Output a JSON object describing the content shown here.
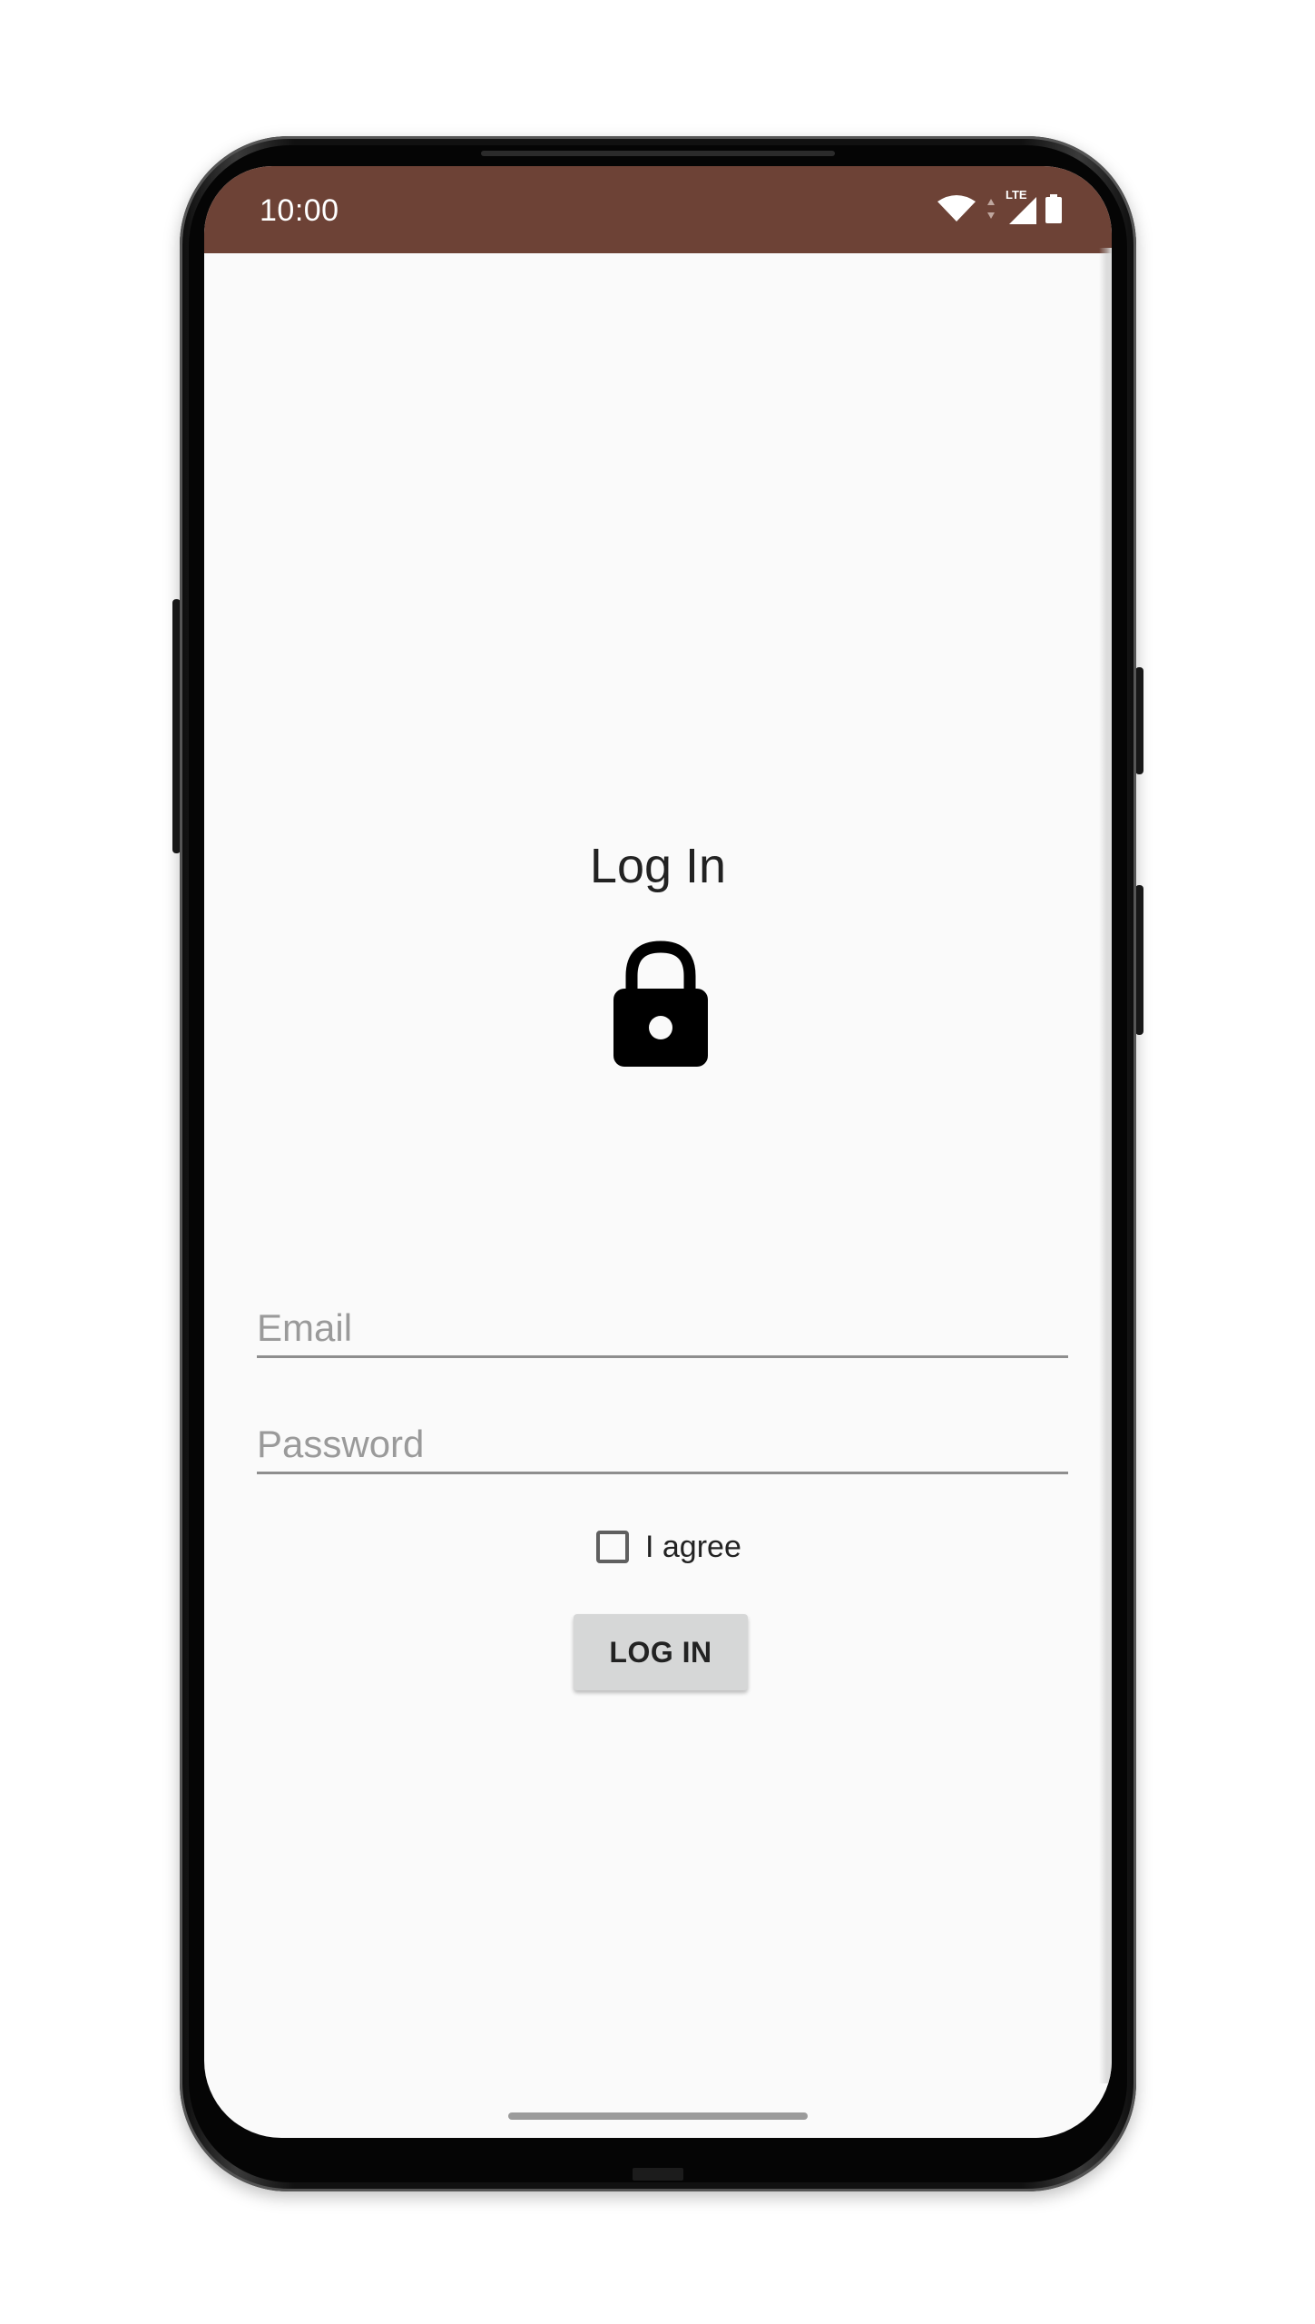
{
  "status_bar": {
    "time": "10:00",
    "network_label": "LTE",
    "color": "#6d4236",
    "icons": [
      "wifi-icon",
      "signal-icon",
      "battery-icon"
    ]
  },
  "login": {
    "title": "Log In",
    "icon": "lock-icon",
    "email_placeholder": "Email",
    "email_value": "",
    "password_placeholder": "Password",
    "password_value": "",
    "agree_label": "I agree",
    "agree_checked": false,
    "button_label": "LOG IN"
  }
}
